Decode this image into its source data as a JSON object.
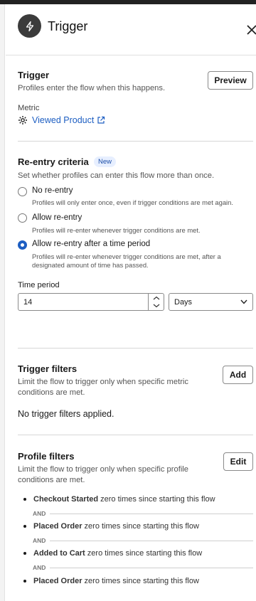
{
  "header": {
    "title": "Trigger"
  },
  "trigger": {
    "heading": "Trigger",
    "description": "Profiles enter the flow when this happens.",
    "preview_label": "Preview",
    "metric_label": "Metric",
    "metric_value": "Viewed Product"
  },
  "reentry": {
    "heading": "Re-entry criteria",
    "badge": "New",
    "description": "Set whether profiles can enter this flow more than once.",
    "options": [
      {
        "label": "No re-entry",
        "sub": "Profiles will only enter once, even if trigger conditions are met again.",
        "selected": false
      },
      {
        "label": "Allow re-entry",
        "sub": "Profiles will re-enter whenever trigger conditions are met.",
        "selected": false
      },
      {
        "label": "Allow re-entry after a time period",
        "sub_line1": "Profiles will re-enter whenever trigger conditions are met, after a",
        "sub_line2": "designated amount of time has passed.",
        "selected": true
      }
    ],
    "time_period_label": "Time period",
    "time_value": "14",
    "unit_value": "Days"
  },
  "trigger_filters": {
    "heading": "Trigger filters",
    "desc_line1": "Limit the flow to trigger only when specific metric",
    "desc_line2": "conditions are met.",
    "add_label": "Add",
    "empty_text": "No trigger filters applied."
  },
  "profile_filters": {
    "heading": "Profile filters",
    "desc_line1": "Limit the flow to trigger only when specific profile",
    "desc_line2": "conditions are met.",
    "edit_label": "Edit",
    "and_label": "AND",
    "items": [
      {
        "name": "Checkout Started",
        "rest": " zero times since starting this flow"
      },
      {
        "name": "Placed Order",
        "rest": " zero times since starting this flow"
      },
      {
        "name": "Added to Cart",
        "rest": " zero times since starting this flow"
      },
      {
        "name": "Placed Order",
        "rest": " zero times since starting this flow"
      }
    ]
  },
  "colors": {
    "accent": "#1d5ec2",
    "icon_bg": "#3b3b3b"
  },
  "icons": [
    "bolt-icon",
    "close-icon",
    "gear-icon",
    "external-link-icon",
    "chevron-down-icon",
    "chevron-up-icon"
  ]
}
